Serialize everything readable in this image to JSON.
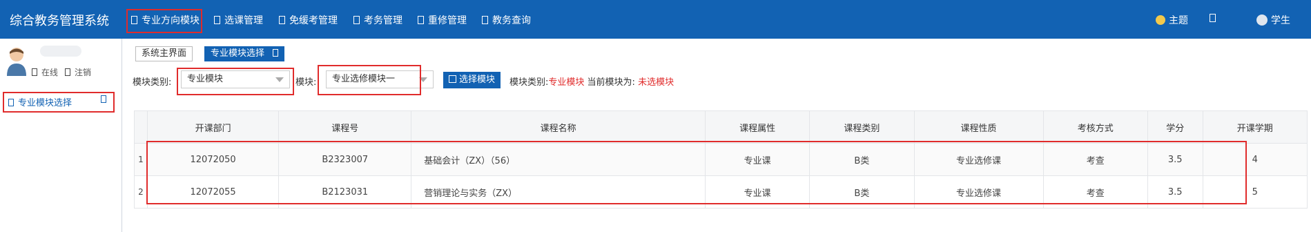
{
  "app": {
    "title": "综合教务管理系统"
  },
  "nav": {
    "items": [
      "专业方向模块",
      "选课管理",
      "免缓考管理",
      "考务管理",
      "重修管理",
      "教务查询"
    ],
    "theme_label": "主题",
    "user_label": "学生"
  },
  "sidebar": {
    "online": "在线",
    "logout": "注销",
    "items": [
      {
        "label": "专业模块选择"
      }
    ]
  },
  "breadcrumb": {
    "home": "系统主界面",
    "current": "专业模块选择"
  },
  "filters": {
    "category_label": "模块类别:",
    "category_value": "专业模块",
    "module_label": "模块:",
    "module_value": "专业选修模块一",
    "select_button": "选择模块",
    "info_prefix": "模块类别:",
    "info_category": "专业模块",
    "info_current_label": "当前模块为:",
    "info_current": "未选模块"
  },
  "table": {
    "headers": [
      "开课部门",
      "课程号",
      "课程名称",
      "课程属性",
      "课程类别",
      "课程性质",
      "考核方式",
      "学分",
      "开课学期"
    ],
    "rows": [
      {
        "n": "1",
        "dept": "12072050",
        "code": "B2323007",
        "name": "基础会计（ZX）（56）",
        "attr": "专业课",
        "cat": "B类",
        "nature": "专业选修课",
        "exam": "考查",
        "credit": "3.5",
        "term": "4"
      },
      {
        "n": "2",
        "dept": "12072055",
        "code": "B2123031",
        "name": "营销理论与实务（ZX）",
        "attr": "专业课",
        "cat": "B类",
        "nature": "专业选修课",
        "exam": "考查",
        "credit": "3.5",
        "term": "5"
      }
    ]
  },
  "colors": {
    "primary": "#1262b3",
    "highlight": "#e02b2b"
  }
}
